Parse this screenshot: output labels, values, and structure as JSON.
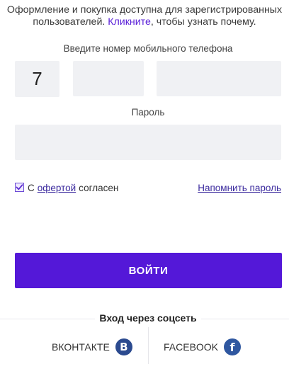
{
  "notice": {
    "text_before": "Оформление и покупка доступна для зарегистрированных пользователей. ",
    "link": "Кликните",
    "text_after": ", чтобы узнать почему."
  },
  "phone": {
    "label": "Введите номер мобильного телефона",
    "code_value": "7",
    "part1_value": "",
    "part2_value": ""
  },
  "password": {
    "label": "Пароль",
    "value": ""
  },
  "agreement": {
    "checked": true,
    "prefix": "С",
    "offer_link": "офертой",
    "suffix": "согласен"
  },
  "remind_password": "Напомнить пароль",
  "login_button": "ВОЙТИ",
  "social": {
    "title": "Вход через соцсеть",
    "vk_label": "ВКОНТАКТЕ",
    "vk_icon": "vk-icon",
    "fb_label": "FACEBOOK",
    "fb_icon": "facebook-icon"
  },
  "colors": {
    "accent": "#5418d8",
    "link": "#3b2a9e",
    "field_bg": "#f0f1f4"
  }
}
